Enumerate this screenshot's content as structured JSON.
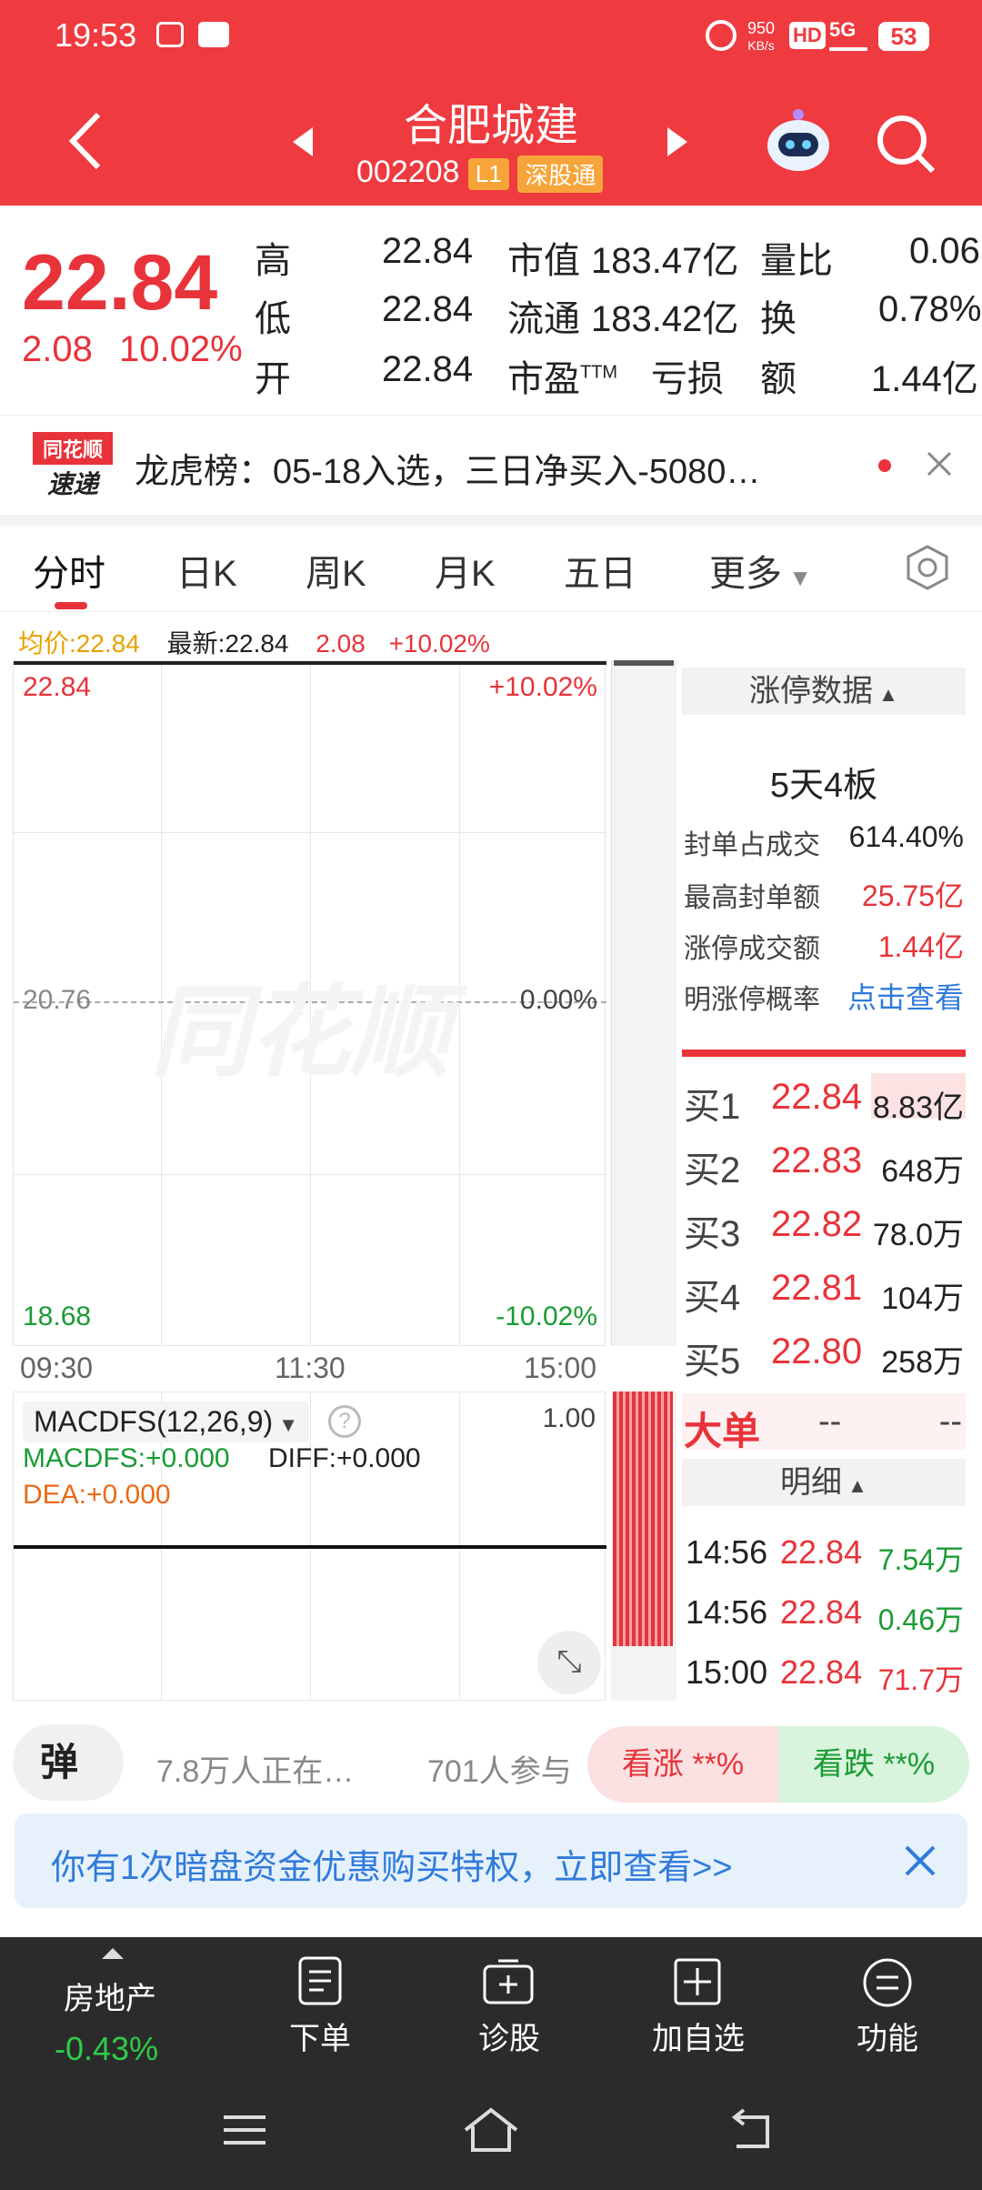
{
  "status_bar": {
    "time": "19:53",
    "speed": "950",
    "speed_unit": "KB/s",
    "hd": "HD",
    "net": "5G",
    "battery": "53"
  },
  "header": {
    "title": "合肥城建",
    "code": "002208",
    "level_badge": "L1",
    "connect_badge": "深股通"
  },
  "quote": {
    "price": "22.84",
    "change": "2.08",
    "change_pct": "10.02%",
    "high_label": "高",
    "high": "22.84",
    "low_label": "低",
    "low": "22.84",
    "open_label": "开",
    "open": "22.84",
    "mktcap_label": "市值",
    "mktcap": "183.47亿",
    "float_label": "流通",
    "float": "183.42亿",
    "pe_label": "市盈",
    "pe_suffix": "TTM",
    "pe": "亏损",
    "volratio_label": "量比",
    "volratio": "0.06",
    "turnover_label": "换",
    "turnover": "0.78%",
    "amount_label": "额",
    "amount": "1.44亿"
  },
  "news": {
    "logo_top": "同花顺",
    "logo_bottom": "速递",
    "text": "龙虎榜：05-18入选，三日净买入-5080…"
  },
  "tabs": [
    "分时",
    "日K",
    "周K",
    "月K",
    "五日",
    "更多"
  ],
  "chart_info": {
    "avg_label": "均价:22.84",
    "latest_label": "最新:22.84",
    "change": "2.08",
    "change_pct": "+10.02%"
  },
  "chart_axes": {
    "top_price": "22.84",
    "top_pct": "+10.02%",
    "mid_price": "20.76",
    "mid_pct": "0.00%",
    "bottom_price": "18.68",
    "bottom_pct": "-10.02%",
    "time_start": "09:30",
    "time_mid": "11:30",
    "time_end": "15:00"
  },
  "chart_data": {
    "type": "line",
    "x": [
      "09:30",
      "11:30",
      "15:00"
    ],
    "series": [
      {
        "values": [
          22.84,
          22.84,
          22.84
        ]
      }
    ],
    "ylim": [
      18.68,
      22.84
    ]
  },
  "macd": {
    "title": "MACDFS(12,26,9)",
    "macdfs": "MACDFS:+0.000",
    "diff": "DIFF:+0.000",
    "dea": "DEA:+0.000",
    "scale": "1.00"
  },
  "limit_panel": {
    "title": "涨停数据",
    "boards": "5天4板",
    "rows": [
      {
        "label": "封单占成交",
        "value": "614.40%"
      },
      {
        "label": "最高封单额",
        "value": "25.75亿"
      },
      {
        "label": "涨停成交额",
        "value": "1.44亿"
      },
      {
        "label": "明涨停概率",
        "value": "点击查看"
      }
    ]
  },
  "order_book": [
    {
      "label": "买1",
      "price": "22.84",
      "vol": "8.83亿"
    },
    {
      "label": "买2",
      "price": "22.83",
      "vol": "648万"
    },
    {
      "label": "买3",
      "price": "22.82",
      "vol": "78.0万"
    },
    {
      "label": "买4",
      "price": "22.81",
      "vol": "104万"
    },
    {
      "label": "买5",
      "price": "22.80",
      "vol": "258万"
    }
  ],
  "big_order": {
    "label": "大单",
    "v1": "--",
    "v2": "--"
  },
  "detail": {
    "title": "明细",
    "rows": [
      {
        "time": "14:56",
        "price": "22.84",
        "vol": "7.54万"
      },
      {
        "time": "14:56",
        "price": "22.84",
        "vol": "0.46万"
      },
      {
        "time": "15:00",
        "price": "22.84",
        "vol": "71.7万"
      }
    ]
  },
  "vote": {
    "danmu": "弹",
    "viewers": "7.8万人正在…",
    "participants": "701人参与",
    "up": "看涨 **%",
    "down": "看跌 **%"
  },
  "promo": {
    "text": "你有1次暗盘资金优惠购买特权，立即查看>>"
  },
  "bottom_nav": {
    "sector": "房地产",
    "sector_change": "-0.43%",
    "items": [
      "下单",
      "诊股",
      "加自选",
      "功能"
    ]
  },
  "colors": {
    "brand_red": "#ef3a3f",
    "up_red": "#e8333a",
    "down_green": "#1a9b33",
    "link_blue": "#2f7bdc",
    "nav_bg": "#2b2b2b"
  }
}
